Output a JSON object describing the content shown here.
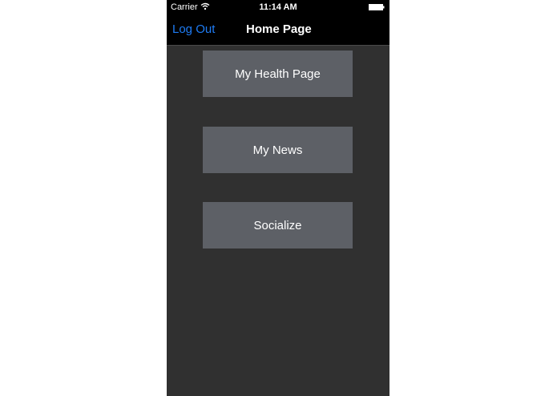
{
  "status_bar": {
    "carrier": "Carrier",
    "time": "11:14 AM",
    "wifi_icon": "wifi-icon",
    "battery_icon": "battery-icon"
  },
  "nav_bar": {
    "logout_label": "Log Out",
    "title": "Home Page"
  },
  "menu": {
    "items": [
      {
        "label": "My Health Page"
      },
      {
        "label": "My News"
      },
      {
        "label": "Socialize"
      }
    ]
  },
  "colors": {
    "background": "#303030",
    "bar": "#000000",
    "accent": "#1e7cf5",
    "button": "#5d6066",
    "text": "#ffffff"
  }
}
